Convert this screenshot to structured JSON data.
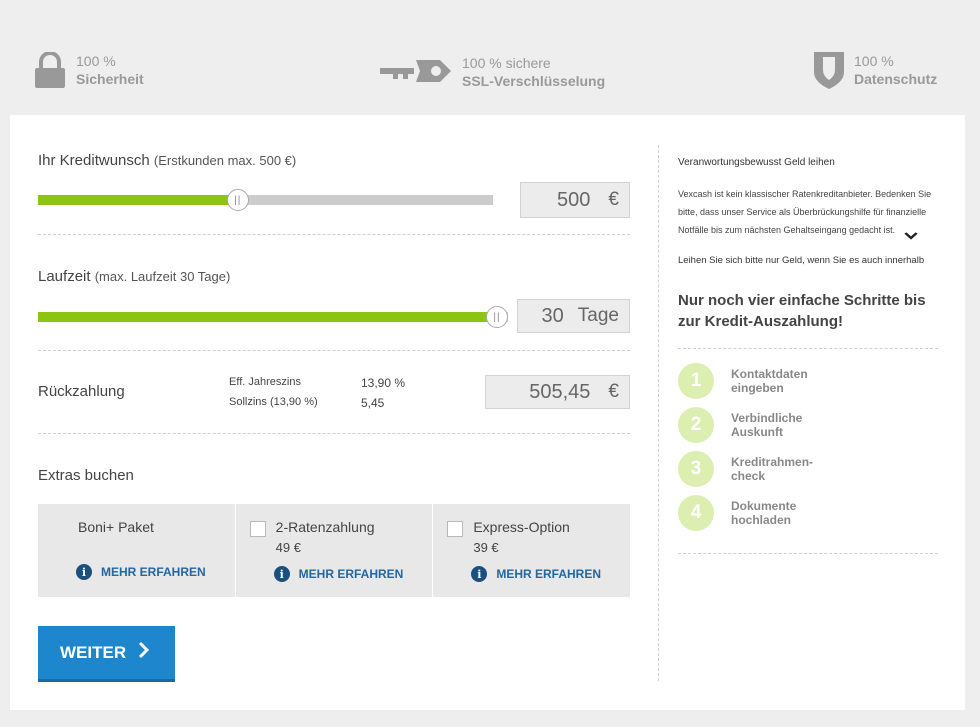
{
  "trust": {
    "security": {
      "pct": "100 %",
      "label": "Sicherheit",
      "icon": "lock-icon"
    },
    "ssl": {
      "pct": "100 % sichere",
      "label": "SSL-Verschlüsselung",
      "icon": "key-icon"
    },
    "privacy": {
      "pct": "100 %",
      "label": "Datenschutz",
      "icon": "shield-icon"
    }
  },
  "credit": {
    "title": "Ihr Kreditwunsch",
    "subtitle": "(Erstkunden max. 500 €)",
    "value": "500",
    "unit": "€",
    "slider_fraction": 0.45
  },
  "term": {
    "title": "Laufzeit",
    "subtitle": "(max. Laufzeit 30 Tage)",
    "value": "30",
    "unit": "Tage",
    "slider_fraction": 1.0
  },
  "repayment": {
    "title": "Rückzahlung",
    "eff_label": "Eff. Jahreszins",
    "eff_value": "13,90 %",
    "soll_label": "Sollzins (13,90 %)",
    "soll_value": "5,45",
    "total": "505,45",
    "unit": "€"
  },
  "extras": {
    "title": "Extras buchen",
    "more_label": "MEHR ERFAHREN",
    "items": [
      {
        "name": "Boni+ Paket",
        "price": ""
      },
      {
        "name": "2-Ratenzahlung",
        "price": "49 €"
      },
      {
        "name": "Express-Option",
        "price": "39 €"
      }
    ]
  },
  "button": {
    "label": "WEITER",
    "icon": "chevron-right-icon"
  },
  "info": {
    "title": "Veranwortungsbewusst Geld leihen",
    "text": "Vexcash ist kein klassischer Ratenkreditanbieter. Bedenken Sie bitte, dass unser Service als Überbrückungshilfe für finanzielle Notfälle bis zum nächsten Gehaltseingang gedacht ist.",
    "more": "Leihen Sie sich bitte nur Geld, wenn Sie es auch innerhalb"
  },
  "steps": {
    "heading": "Nur noch vier einfache Schritte bis zur Kredit-Auszahlung!",
    "items": [
      {
        "num": "1",
        "line1": "Kontaktdaten",
        "line2": "eingeben"
      },
      {
        "num": "2",
        "line1": "Verbindliche",
        "line2": "Auskunft"
      },
      {
        "num": "3",
        "line1": "Kreditrahmen-",
        "line2": "check"
      },
      {
        "num": "4",
        "line1": "Dokumente",
        "line2": "hochladen"
      }
    ]
  },
  "colors": {
    "accent_green": "#8cc411",
    "button_blue": "#1e86cc",
    "step_circle": "#dceeb0",
    "info_icon": "#1b4f7e"
  }
}
